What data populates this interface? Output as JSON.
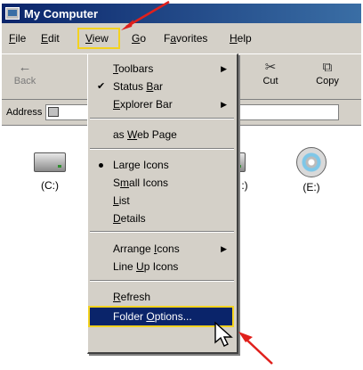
{
  "window": {
    "title": "My Computer"
  },
  "menubar": {
    "items": [
      {
        "pre": "",
        "ul": "F",
        "post": "ile"
      },
      {
        "pre": "",
        "ul": "E",
        "post": "dit"
      },
      {
        "pre": "",
        "ul": "V",
        "post": "iew"
      },
      {
        "pre": "",
        "ul": "G",
        "post": "o"
      },
      {
        "pre": "F",
        "ul": "a",
        "post": "vorites"
      },
      {
        "pre": "",
        "ul": "H",
        "post": "elp"
      }
    ]
  },
  "toolbar": {
    "back_label": "Back",
    "cut_label": "Cut",
    "copy_label": "Copy"
  },
  "addressbar": {
    "label": "Address"
  },
  "drives": [
    {
      "label": "(C:)"
    },
    {
      "label": "(E:)"
    }
  ],
  "partial_label": ":)",
  "view_menu": {
    "toolbars": {
      "pre": "",
      "ul": "T",
      "post": "oolbars"
    },
    "status_bar": {
      "pre": "Status ",
      "ul": "B",
      "post": "ar"
    },
    "explorer_bar": {
      "pre": "",
      "ul": "E",
      "post": "xplorer Bar"
    },
    "web_page": {
      "pre": "as ",
      "ul": "W",
      "post": "eb Page"
    },
    "large_icons": {
      "pre": "Lar",
      "ul": "g",
      "post": "e Icons"
    },
    "small_icons": {
      "pre": "S",
      "ul": "m",
      "post": "all Icons"
    },
    "list": {
      "pre": "",
      "ul": "L",
      "post": "ist"
    },
    "details": {
      "pre": "",
      "ul": "D",
      "post": "etails"
    },
    "arrange_icons": {
      "pre": "Arrange ",
      "ul": "I",
      "post": "cons"
    },
    "line_up_icons": {
      "pre": "Line ",
      "ul": "U",
      "post": "p Icons"
    },
    "refresh": {
      "pre": "",
      "ul": "R",
      "post": "efresh"
    },
    "folder_options": {
      "pre": "Folder ",
      "ul": "O",
      "post": "ptions..."
    }
  },
  "colors": {
    "highlight": "#0a246a",
    "callout": "#f3d21f",
    "arrow": "#e0201c"
  },
  "icons": [
    "computer-icon",
    "back-arrow-icon",
    "scissors-icon",
    "copy-icon",
    "hard-drive-icon",
    "cd-drive-icon",
    "checkmark-icon",
    "radio-bullet-icon",
    "submenu-arrow-icon",
    "mouse-cursor-icon",
    "red-arrow-icon"
  ]
}
